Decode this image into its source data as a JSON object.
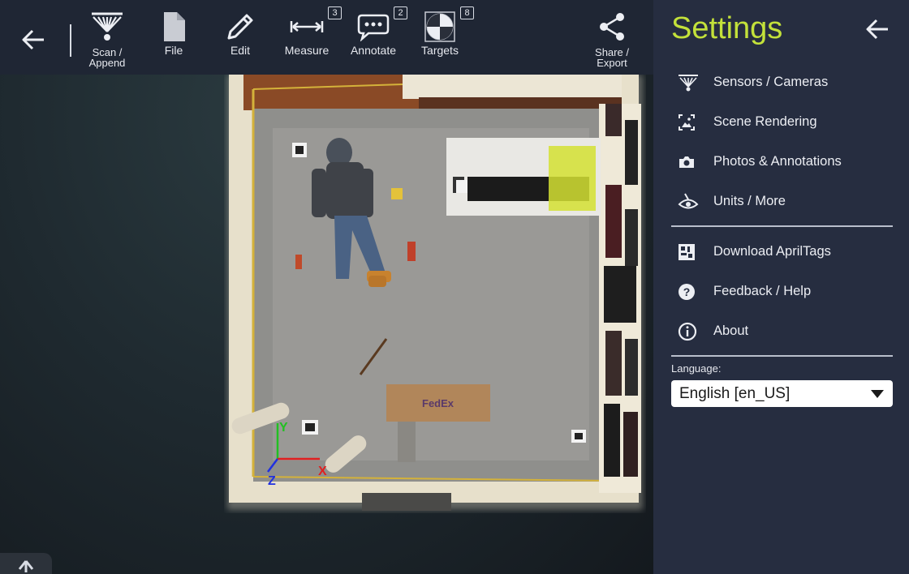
{
  "toolbar": {
    "tools": [
      {
        "id": "scan",
        "label_line1": "Scan /",
        "label_line2": "Append",
        "icon": "scan-icon"
      },
      {
        "id": "file",
        "label": "File",
        "icon": "file-icon"
      },
      {
        "id": "edit",
        "label": "Edit",
        "icon": "pencil-icon"
      },
      {
        "id": "measure",
        "label": "Measure",
        "icon": "measure-icon",
        "badge": "3"
      },
      {
        "id": "annotate",
        "label": "Annotate",
        "icon": "speech-bubble-icon",
        "badge": "2"
      },
      {
        "id": "targets",
        "label": "Targets",
        "icon": "target-icon",
        "badge": "8"
      },
      {
        "id": "share",
        "label_line1": "Share /",
        "label_line2": "Export",
        "icon": "share-icon"
      }
    ]
  },
  "settings": {
    "title": "Settings",
    "items": [
      {
        "label": "Sensors / Cameras",
        "icon": "sensor-icon"
      },
      {
        "label": "Scene Rendering",
        "icon": "image-icon"
      },
      {
        "label": "Photos & Annotations",
        "icon": "camera-icon"
      },
      {
        "label": "Units / More",
        "icon": "eye-icon"
      },
      {
        "label": "Download AprilTags",
        "icon": "apriltag-icon"
      },
      {
        "label": "Feedback / Help",
        "icon": "help-icon"
      },
      {
        "label": "About",
        "icon": "info-icon"
      }
    ],
    "language_label": "Language:",
    "language_value": "English [en_US]"
  },
  "viewport": {
    "axis_labels": {
      "x": "X",
      "y": "Y",
      "z": "Z"
    },
    "box_text": "FedEx"
  },
  "colors": {
    "accent": "#c3e13a",
    "toolbar_bg": "#1f2634",
    "panel_bg": "#262d40",
    "axis_x": "#e02020",
    "axis_y": "#22c022",
    "axis_z": "#2030e0"
  }
}
